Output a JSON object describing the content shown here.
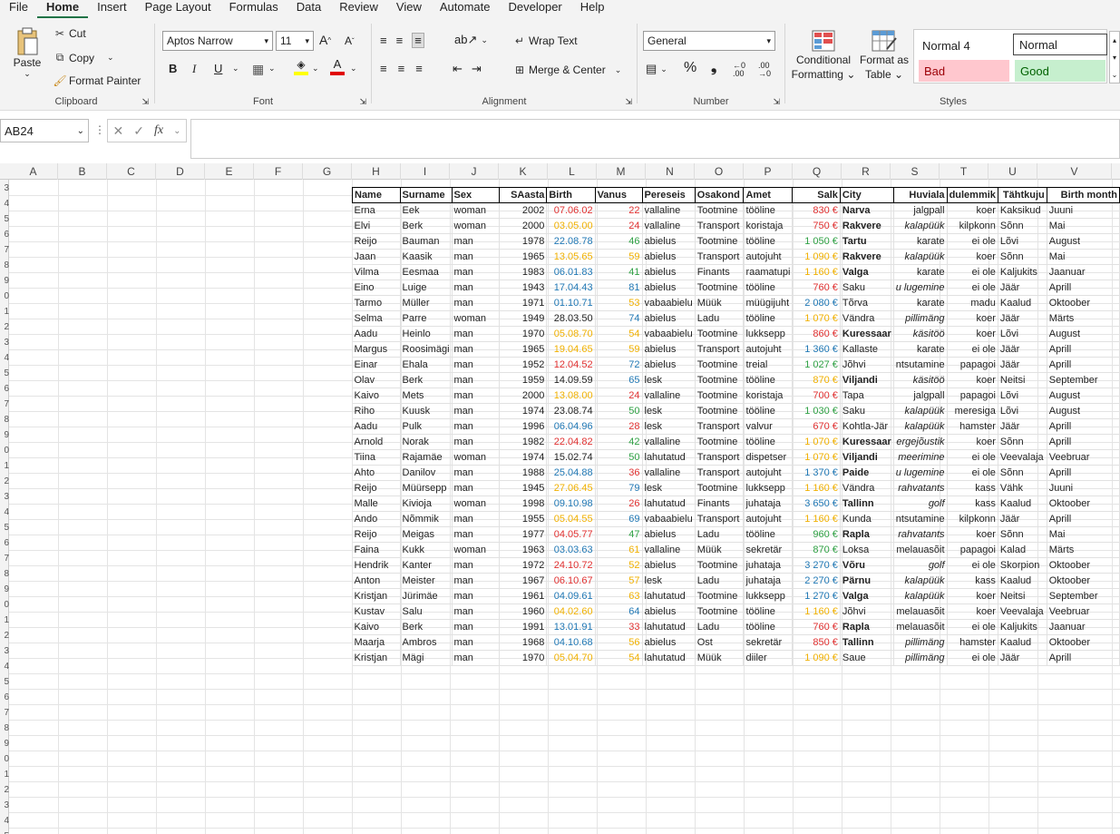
{
  "menu": [
    "File",
    "Home",
    "Insert",
    "Page Layout",
    "Formulas",
    "Data",
    "Review",
    "View",
    "Automate",
    "Developer",
    "Help"
  ],
  "clipboard": {
    "paste": "Paste",
    "cut": "Cut",
    "copy": "Copy",
    "format_painter": "Format Painter",
    "label": "Clipboard"
  },
  "font": {
    "name": "Aptos Narrow",
    "size": "11",
    "label": "Font",
    "bold": "B",
    "italic": "I",
    "underline": "U"
  },
  "alignment": {
    "wrap": "Wrap Text",
    "merge": "Merge & Center",
    "label": "Alignment"
  },
  "number": {
    "format": "General",
    "label": "Number"
  },
  "styles": {
    "conditional": [
      "Conditional",
      "Formatting"
    ],
    "format_table": [
      "Format as",
      "Table"
    ],
    "normal4": "Normal 4",
    "normal": "Normal",
    "bad": "Bad",
    "good": "Good",
    "label": "Styles"
  },
  "namebox": "AB24",
  "columns": [
    "A",
    "B",
    "C",
    "D",
    "E",
    "F",
    "G",
    "H",
    "I",
    "J",
    "K",
    "L",
    "M",
    "N",
    "O",
    "P",
    "Q",
    "R",
    "S",
    "T",
    "U",
    "V"
  ],
  "row_numbers": [
    "3",
    "4",
    "5",
    "6",
    "7",
    "8",
    "9",
    "0",
    "1",
    "2",
    "3",
    "4",
    "5",
    "6",
    "7",
    "8",
    "9",
    "0",
    "1",
    "2",
    "3",
    "4",
    "5",
    "6",
    "7",
    "8",
    "9",
    "0",
    "1",
    "2",
    "3",
    "4",
    "5",
    "6",
    "7",
    "8",
    "9",
    "0",
    "1",
    "2",
    "3",
    "4",
    "5",
    "6"
  ],
  "table_headers": [
    "Name",
    "Surname",
    "Sex",
    "SAasta",
    "Birth",
    "Vanus",
    "Pereseis",
    "Osakond",
    "Amet",
    "Salk",
    "City",
    "Huviala",
    "dulemmik",
    "Tähtkuju",
    "Birth month"
  ],
  "rows": [
    [
      "Erna",
      "Eek",
      "woman",
      "2002",
      "07.06.02",
      "22",
      "vallaline",
      "Tootmine",
      "tööline",
      "830 €",
      "Narva",
      "jalgpall",
      "koer",
      "Kaksikud",
      "Juuni"
    ],
    [
      "Elvi",
      "Berk",
      "woman",
      "2000",
      "03.05.00",
      "24",
      "vallaline",
      "Transport",
      "koristaja",
      "750 €",
      "Rakvere",
      "kalapüük",
      "kilpkonn",
      "Sõnn",
      "Mai"
    ],
    [
      "Reijo",
      "Bauman",
      "man",
      "1978",
      "22.08.78",
      "46",
      "abielus",
      "Tootmine",
      "tööline",
      "1 050 €",
      "Tartu",
      "karate",
      "ei ole",
      "Lõvi",
      "August"
    ],
    [
      "Jaan",
      "Kaasik",
      "man",
      "1965",
      "13.05.65",
      "59",
      "abielus",
      "Transport",
      "autojuht",
      "1 090 €",
      "Rakvere",
      "kalapüük",
      "koer",
      "Sõnn",
      "Mai"
    ],
    [
      "Vilma",
      "Eesmaa",
      "man",
      "1983",
      "06.01.83",
      "41",
      "abielus",
      "Finants",
      "raamatupi",
      "1 160 €",
      "Valga",
      "karate",
      "ei ole",
      "Kaljukits",
      "Jaanuar"
    ],
    [
      "Eino",
      "Luige",
      "man",
      "1943",
      "17.04.43",
      "81",
      "abielus",
      "Tootmine",
      "tööline",
      "760 €",
      "Saku",
      "u lugemine",
      "ei ole",
      "Jäär",
      "Aprill"
    ],
    [
      "Tarmo",
      "Müller",
      "man",
      "1971",
      "01.10.71",
      "53",
      "vabaabielu",
      "Müük",
      "müügijuht",
      "2 080 €",
      "Tõrva",
      "karate",
      "madu",
      "Kaalud",
      "Oktoober"
    ],
    [
      "Selma",
      "Parre",
      "woman",
      "1949",
      "28.03.50",
      "74",
      "abielus",
      "Ladu",
      "tööline",
      "1 070 €",
      "Vändra",
      "pillimäng",
      "koer",
      "Jäär",
      "Märts"
    ],
    [
      "Aadu",
      "Heinlo",
      "man",
      "1970",
      "05.08.70",
      "54",
      "vabaabielu",
      "Tootmine",
      "lukksepp",
      "860 €",
      "Kuressaar",
      "käsitöö",
      "koer",
      "Lõvi",
      "August"
    ],
    [
      "Margus",
      "Roosimägi",
      "man",
      "1965",
      "19.04.65",
      "59",
      "abielus",
      "Transport",
      "autojuht",
      "1 360 €",
      "Kallaste",
      "karate",
      "ei ole",
      "Jäär",
      "Aprill"
    ],
    [
      "Einar",
      "Ehala",
      "man",
      "1952",
      "12.04.52",
      "72",
      "abielus",
      "Tootmine",
      "treial",
      "1 027 €",
      "Jõhvi",
      "ntsutamine",
      "papagoi",
      "Jäär",
      "Aprill"
    ],
    [
      "Olav",
      "Berk",
      "man",
      "1959",
      "14.09.59",
      "65",
      "lesk",
      "Tootmine",
      "tööline",
      "870 €",
      "Viljandi",
      "käsitöö",
      "koer",
      "Neitsi",
      "September"
    ],
    [
      "Kaivo",
      "Mets",
      "man",
      "2000",
      "13.08.00",
      "24",
      "vallaline",
      "Tootmine",
      "koristaja",
      "700 €",
      "Tapa",
      "jalgpall",
      "papagoi",
      "Lõvi",
      "August"
    ],
    [
      "Riho",
      "Kuusk",
      "man",
      "1974",
      "23.08.74",
      "50",
      "lesk",
      "Tootmine",
      "tööline",
      "1 030 €",
      "Saku",
      "kalapüük",
      "meresiga",
      "Lõvi",
      "August"
    ],
    [
      "Aadu",
      "Pulk",
      "man",
      "1996",
      "06.04.96",
      "28",
      "lesk",
      "Transport",
      "valvur",
      "670 €",
      "Kohtla-Jär",
      "kalapüük",
      "hamster",
      "Jäär",
      "Aprill"
    ],
    [
      "Arnold",
      "Norak",
      "man",
      "1982",
      "22.04.82",
      "42",
      "vallaline",
      "Tootmine",
      "tööline",
      "1 070 €",
      "Kuressaar",
      "ergejõustik",
      "koer",
      "Sõnn",
      "Aprill"
    ],
    [
      "Tiina",
      "Rajamäe",
      "woman",
      "1974",
      "15.02.74",
      "50",
      "lahutatud",
      "Transport",
      "dispetser",
      "1 070 €",
      "Viljandi",
      "meerimine",
      "ei ole",
      "Veevalaja",
      "Veebruar"
    ],
    [
      "Ahto",
      "Danilov",
      "man",
      "1988",
      "25.04.88",
      "36",
      "vallaline",
      "Transport",
      "autojuht",
      "1 370 €",
      "Paide",
      "u lugemine",
      "ei ole",
      "Sõnn",
      "Aprill"
    ],
    [
      "Reijo",
      "Müürsepp",
      "man",
      "1945",
      "27.06.45",
      "79",
      "lesk",
      "Tootmine",
      "lukksepp",
      "1 160 €",
      "Vändra",
      "rahvatants",
      "kass",
      "Vähk",
      "Juuni"
    ],
    [
      "Malle",
      "Kivioja",
      "woman",
      "1998",
      "09.10.98",
      "26",
      "lahutatud",
      "Finants",
      "juhataja",
      "3 650 €",
      "Tallinn",
      "golf",
      "kass",
      "Kaalud",
      "Oktoober"
    ],
    [
      "Ando",
      "Nõmmik",
      "man",
      "1955",
      "05.04.55",
      "69",
      "vabaabielu",
      "Transport",
      "autojuht",
      "1 160 €",
      "Kunda",
      "ntsutamine",
      "kilpkonn",
      "Jäär",
      "Aprill"
    ],
    [
      "Reijo",
      "Meigas",
      "man",
      "1977",
      "04.05.77",
      "47",
      "abielus",
      "Ladu",
      "tööline",
      "960 €",
      "Rapla",
      "rahvatants",
      "koer",
      "Sõnn",
      "Mai"
    ],
    [
      "Faina",
      "Kukk",
      "woman",
      "1963",
      "03.03.63",
      "61",
      "vallaline",
      "Müük",
      "sekretär",
      "870 €",
      "Loksa",
      "melauasõit",
      "papagoi",
      "Kalad",
      "Märts"
    ],
    [
      "Hendrik",
      "Kanter",
      "man",
      "1972",
      "24.10.72",
      "52",
      "abielus",
      "Tootmine",
      "juhataja",
      "3 270 €",
      "Võru",
      "golf",
      "ei ole",
      "Skorpion",
      "Oktoober"
    ],
    [
      "Anton",
      "Meister",
      "man",
      "1967",
      "06.10.67",
      "57",
      "lesk",
      "Ladu",
      "juhataja",
      "2 270 €",
      "Pärnu",
      "kalapüük",
      "kass",
      "Kaalud",
      "Oktoober"
    ],
    [
      "Kristjan",
      "Jürimäe",
      "man",
      "1961",
      "04.09.61",
      "63",
      "lahutatud",
      "Tootmine",
      "lukksepp",
      "1 270 €",
      "Valga",
      "kalapüük",
      "koer",
      "Neitsi",
      "September"
    ],
    [
      "Kustav",
      "Salu",
      "man",
      "1960",
      "04.02.60",
      "64",
      "abielus",
      "Tootmine",
      "tööline",
      "1 160 €",
      "Jõhvi",
      "melauasõit",
      "koer",
      "Veevalaja",
      "Veebruar"
    ],
    [
      "Kaivo",
      "Berk",
      "man",
      "1991",
      "13.01.91",
      "33",
      "lahutatud",
      "Ladu",
      "tööline",
      "760 €",
      "Rapla",
      "melauasõit",
      "ei ole",
      "Kaljukits",
      "Jaanuar"
    ],
    [
      "Maarja",
      "Ambros",
      "man",
      "1968",
      "04.10.68",
      "56",
      "abielus",
      "Ost",
      "sekretär",
      "850 €",
      "Tallinn",
      "pillimäng",
      "hamster",
      "Kaalud",
      "Oktoober"
    ],
    [
      "Kristjan",
      "Mägi",
      "man",
      "1970",
      "05.04.70",
      "54",
      "lahutatud",
      "Müük",
      "diiler",
      "1 090 €",
      "Saue",
      "pillimäng",
      "ei ole",
      "Jäär",
      "Aprill"
    ]
  ],
  "birth_colors": [
    "red",
    "orange",
    "blue",
    "orange",
    "blue",
    "blue",
    "blue",
    "black",
    "orange",
    "orange",
    "red",
    "black",
    "orange",
    "black",
    "blue",
    "red",
    "black",
    "blue",
    "orange",
    "blue",
    "orange",
    "red",
    "blue",
    "red",
    "red",
    "blue",
    "orange",
    "blue",
    "blue",
    "orange"
  ],
  "age_colors": [
    "red",
    "red",
    "green",
    "orange",
    "green",
    "blue",
    "orange",
    "blue",
    "orange",
    "orange",
    "blue",
    "blue",
    "red",
    "green",
    "red",
    "green",
    "green",
    "red",
    "blue",
    "red",
    "blue",
    "green",
    "orange",
    "orange",
    "orange",
    "orange",
    "blue",
    "red",
    "orange",
    "orange"
  ],
  "salary_colors": [
    "red",
    "red",
    "green",
    "orange",
    "orange",
    "red",
    "blue",
    "orange",
    "red",
    "blue",
    "green",
    "orange",
    "red",
    "green",
    "red",
    "orange",
    "orange",
    "blue",
    "orange",
    "blue",
    "orange",
    "green",
    "green",
    "blue",
    "blue",
    "blue",
    "orange",
    "red",
    "red",
    "orange"
  ],
  "bold_city": [
    true,
    true,
    true,
    true,
    true,
    false,
    false,
    false,
    true,
    false,
    false,
    true,
    false,
    false,
    false,
    true,
    true,
    true,
    false,
    true,
    false,
    true,
    false,
    true,
    true,
    true,
    false,
    true,
    true,
    false
  ],
  "italic_hobby": [
    false,
    true,
    false,
    true,
    false,
    true,
    false,
    true,
    true,
    false,
    false,
    true,
    false,
    true,
    true,
    true,
    true,
    true,
    true,
    true,
    false,
    true,
    false,
    true,
    true,
    true,
    false,
    false,
    true,
    true
  ]
}
